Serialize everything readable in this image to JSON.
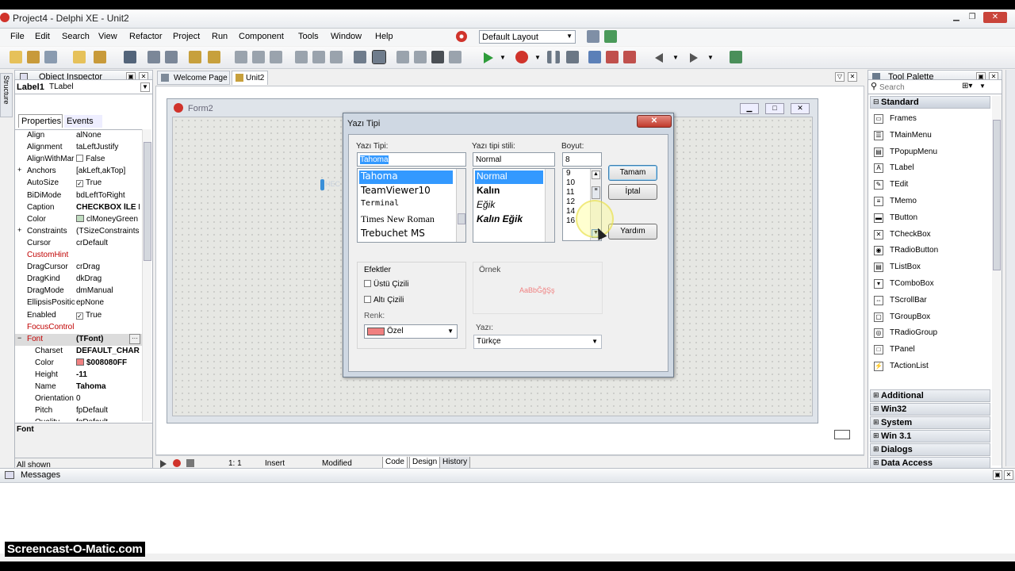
{
  "window": {
    "title": "Project4 - Delphi XE - Unit2"
  },
  "menu": [
    "File",
    "Edit",
    "Search",
    "View",
    "Refactor",
    "Project",
    "Run",
    "Component",
    "Tools",
    "Window",
    "Help"
  ],
  "layout_select": "Default Layout",
  "structure_tab": "Structure",
  "object_inspector": {
    "title": "Object Inspector",
    "object_name": "Label1",
    "object_type": "TLabel",
    "tabs": [
      "Properties",
      "Events"
    ],
    "props": [
      {
        "n": "Align",
        "v": "alNone"
      },
      {
        "n": "Alignment",
        "v": "taLeftJustify"
      },
      {
        "n": "AlignWithMar",
        "v": "False"
      },
      {
        "n": "Anchors",
        "v": "[akLeft,akTop]"
      },
      {
        "n": "AutoSize",
        "v": "True"
      },
      {
        "n": "BiDiMode",
        "v": "bdLeftToRight"
      },
      {
        "n": "Caption",
        "v": "CHECKBOX İLE F"
      },
      {
        "n": "Color",
        "v": "clMoneyGreen"
      },
      {
        "n": "Constraints",
        "v": "(TSizeConstraints"
      },
      {
        "n": "Cursor",
        "v": "crDefault"
      },
      {
        "n": "CustomHint",
        "v": ""
      },
      {
        "n": "DragCursor",
        "v": "crDrag"
      },
      {
        "n": "DragKind",
        "v": "dkDrag"
      },
      {
        "n": "DragMode",
        "v": "dmManual"
      },
      {
        "n": "EllipsisPosition",
        "v": "epNone"
      },
      {
        "n": "Enabled",
        "v": "True"
      },
      {
        "n": "FocusControl",
        "v": ""
      },
      {
        "n": "Font",
        "v": "(TFont)"
      },
      {
        "n": "Charset",
        "v": "DEFAULT_CHAR"
      },
      {
        "n": "Color",
        "v": "$008080FF"
      },
      {
        "n": "Height",
        "v": "-11"
      },
      {
        "n": "Name",
        "v": "Tahoma"
      },
      {
        "n": "Orientation",
        "v": "0"
      },
      {
        "n": "Pitch",
        "v": "fpDefault"
      },
      {
        "n": "Quality",
        "v": "fqDefault"
      }
    ],
    "selected_prop": "Font",
    "footer": "All shown"
  },
  "tabs": {
    "welcome": "Welcome Page",
    "unit": "Unit2"
  },
  "form": {
    "title": "Form2",
    "label_fragment": "HEC"
  },
  "font_dialog": {
    "title": "Yazı Tipi",
    "font_label": "Yazı Tipi:",
    "font_value": "Tahoma",
    "fonts": [
      "Tahoma",
      "TeamViewer10",
      "Terminal",
      "Times New Roman",
      "Trebuchet MS"
    ],
    "style_label": "Yazı tipi stili:",
    "style_value": "Normal",
    "styles": [
      "Normal",
      "Kalın",
      "Eğik",
      "Kalın Eğik"
    ],
    "size_label": "Boyut:",
    "size_value": "8",
    "sizes": [
      "9",
      "10",
      "11",
      "12",
      "14",
      "16"
    ],
    "ok": "Tamam",
    "cancel": "İptal",
    "help": "Yardım",
    "effects_label": "Efektler",
    "strike": "Üstü Çizili",
    "underline": "Altı Çizili",
    "color_label": "Renk:",
    "color_value": "Özel",
    "color_swatch": "#f08080",
    "sample_label": "Örnek",
    "sample_text": "AaBbĞğŞş",
    "script_label": "Yazı:",
    "script_value": "Türkçe"
  },
  "status": {
    "pos": "1:   1",
    "mode": "Insert",
    "state": "Modified",
    "tabs": [
      "Code",
      "Design",
      "History"
    ]
  },
  "tool_palette": {
    "title": "Tool Palette",
    "search_placeholder": "Search",
    "open_category": "Standard",
    "items": [
      {
        "name": "Frames",
        "icon": "frame-icon"
      },
      {
        "name": "TMainMenu",
        "icon": "mainmenu-icon"
      },
      {
        "name": "TPopupMenu",
        "icon": "popupmenu-icon"
      },
      {
        "name": "TLabel",
        "icon": "label-icon"
      },
      {
        "name": "TEdit",
        "icon": "edit-icon"
      },
      {
        "name": "TMemo",
        "icon": "memo-icon"
      },
      {
        "name": "TButton",
        "icon": "button-icon"
      },
      {
        "name": "TCheckBox",
        "icon": "checkbox-icon"
      },
      {
        "name": "TRadioButton",
        "icon": "radiobutton-icon"
      },
      {
        "name": "TListBox",
        "icon": "listbox-icon"
      },
      {
        "name": "TComboBox",
        "icon": "combobox-icon"
      },
      {
        "name": "TScrollBar",
        "icon": "scrollbar-icon"
      },
      {
        "name": "TGroupBox",
        "icon": "groupbox-icon"
      },
      {
        "name": "TRadioGroup",
        "icon": "radiogroup-icon"
      },
      {
        "name": "TPanel",
        "icon": "panel-icon"
      },
      {
        "name": "TActionList",
        "icon": "actionlist-icon"
      }
    ],
    "categories": [
      "Additional",
      "Win32",
      "System",
      "Win 3.1",
      "Dialogs",
      "Data Access"
    ]
  },
  "messages": {
    "title": "Messages"
  },
  "watermark": "Screencast-O-Matic.com",
  "colors": {
    "accent": "#3399ff",
    "form_bg": "#e6e7e3",
    "dialog_frame": "#cfd8e3",
    "close_red": "#c9443a"
  }
}
